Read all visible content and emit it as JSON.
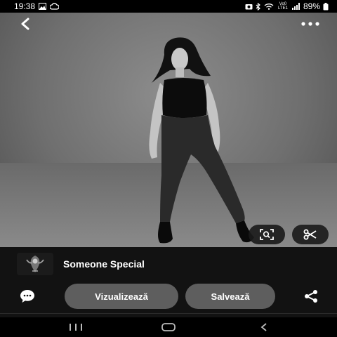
{
  "status_bar": {
    "time": "19:38",
    "battery": "89%",
    "network": "Vo0 LTE1",
    "icons": [
      "image-icon",
      "cloud-icon",
      "camera-icon",
      "bluetooth-icon",
      "wifi-icon",
      "signal-icon",
      "battery-icon"
    ]
  },
  "top_bar": {
    "back_icon": "chevron-left-icon",
    "more_icon": "more-horizontal-icon"
  },
  "photo": {
    "description_icon": "photo-image",
    "actions": [
      "visual-search-icon",
      "scissors-icon"
    ]
  },
  "creator": {
    "name": "Someone Special",
    "avatar_icon": "avatar-logo"
  },
  "actions": {
    "comment_icon": "comment-icon",
    "view_label": "Vizualizează",
    "save_label": "Salvează",
    "share_icon": "share-icon"
  },
  "navbar": {
    "items": [
      "recent-apps-icon",
      "home-icon",
      "back-icon"
    ]
  },
  "colors": {
    "panel_bg": "#121212",
    "pill_bg": "#5e5e5e",
    "photo_bg": "#7a7a7a"
  }
}
